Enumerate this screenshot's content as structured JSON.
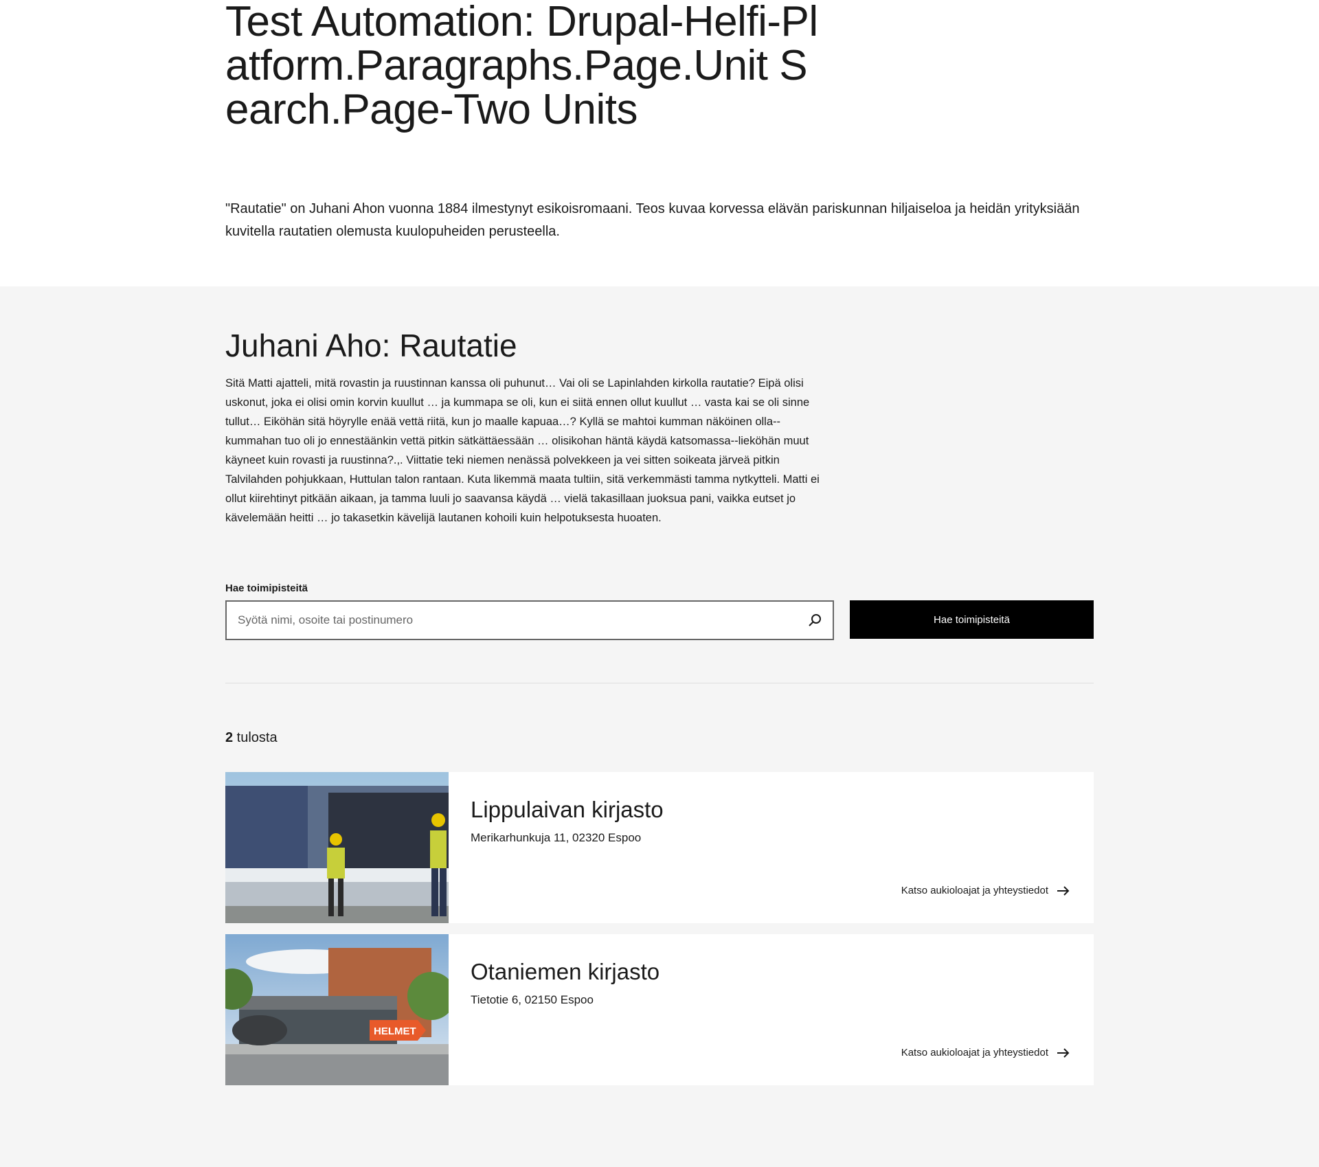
{
  "page": {
    "title": "Test Automation: Drupal-Helfi-Platform.Paragraphs.Page.Unit Search.Page-Two Units",
    "lead": "\"Rautatie\" on Juhani Ahon vuonna 1884 ilmestynyt esikoisromaani. Teos kuvaa korvessa elävän pariskunnan hiljaiseloa ja heidän yrityksiään kuvitella rautatien olemusta kuulopuheiden perusteella."
  },
  "unit_search": {
    "title": "Juhani Aho: Rautatie",
    "text": "Sitä Matti ajatteli, mitä rovastin ja ruustinnan kanssa oli puhunut… Vai oli se Lapinlahden kirkolla rautatie? Eipä olisi uskonut, joka ei olisi omin korvin kuullut … ja kummapa se oli, kun ei siitä ennen ollut kuullut … vasta kai se oli sinne tullut… Eiköhän sitä höyrylle enää vettä riitä, kun jo maalle kapuaa…? Kyllä se mahtoi kumman näköinen olla--kummahan tuo oli jo ennestäänkin vettä pitkin sätkättäessään … olisikohan häntä käydä katsomassa--liekö­hän muut käyneet kuin rovasti ja ruustinna?.,. Viittatie teki niemen nenässä polvekkeen ja vei sitten soikeata järveä pitkin Talvilahden pohjukkaan, Huttulan talon rantaan. Kuta likemmä maata tultiin, sitä verkemmästi tamma nytkytteli. Matti ei ollut kiirehtinyt pitkään aikaan, ja tamma luuli jo saavansa käydä … vielä takasillaan juoksua pani, vaikka eutset jo kävelemään heitti … jo takasetkin kävelijä lautanen kohoili kuin helpotuksesta huoaten.",
    "search_label": "Hae toimipisteitä",
    "search_placeholder": "Syötä nimi, osoite tai postinumero",
    "search_button": "Hae toimipisteitä",
    "results_count": "2",
    "results_suffix": " tulosta",
    "results": [
      {
        "name": "Lippulaivan kirjasto",
        "address": "Merikarhunkuja 11, 02320 Espoo",
        "link": "Katso aukioloajat ja yhteystiedot"
      },
      {
        "name": "Otaniemen kirjasto",
        "address": "Tietotie 6, 02150 Espoo",
        "link": "Katso aukioloajat ja yhteystiedot"
      }
    ],
    "sign_text": "HELMET"
  }
}
